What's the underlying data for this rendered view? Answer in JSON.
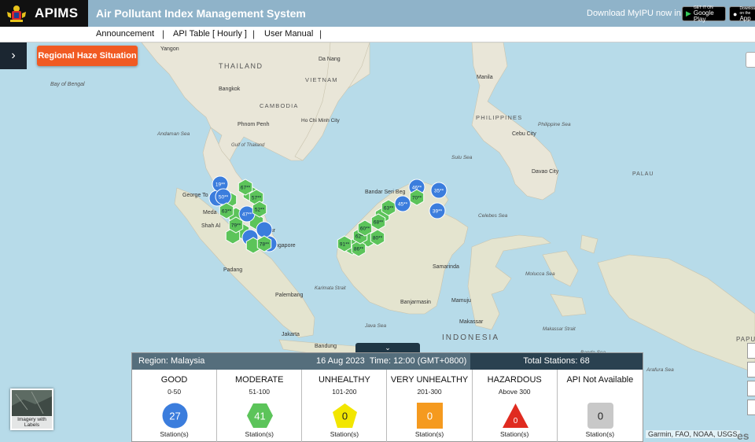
{
  "header": {
    "brand": "APIMS",
    "title": "Air Pollutant Index Management System",
    "download_text": "Download MyIPU now in",
    "google_play_small": "GET IT ON",
    "google_play": "Google Play",
    "app_store_small": "Download on the",
    "app_store": "App"
  },
  "nav": {
    "items": [
      "Announcement",
      "API Table [ Hourly ]",
      "User Manual"
    ]
  },
  "haze_button": "Regional Haze Situation",
  "sidebar_toggle": "›",
  "basemap": {
    "caption": "Imagery with Labels"
  },
  "collapse_arrow": "⌄",
  "map_labels": {
    "countries": [
      "THAILAND",
      "VIETNAM",
      "CAMBODIA",
      "PHILIPPINES",
      "INDONESIA",
      "PALAU",
      "PAPU"
    ],
    "places": [
      "Yangon",
      "Da Nang",
      "Bangkok",
      "Manila",
      "Phnom Penh",
      "Ho Chi Minh City",
      "George To",
      "Meda",
      "Shah Al",
      "pur",
      "ngapore",
      "Padang",
      "Palembang",
      "Jakarta",
      "Bandung",
      "Bandar Seri Beg",
      "Cebu City",
      "Davao City",
      "Samarinda",
      "Banjarmasin",
      "Makassar",
      "Mamuju"
    ],
    "seas": [
      "Bay of Bengal",
      "Andaman Sea",
      "Gulf of Thailand",
      "Philippine Sea",
      "Sulu Sea",
      "Celebes Sea",
      "Molucca Sea",
      "Banda Sea",
      "Java Sea",
      "Karimata Strait",
      "Arafura Sea",
      "Makassar Strait"
    ]
  },
  "stations": [
    {
      "v": "19",
      "t": "good"
    },
    {
      "v": "50",
      "t": "good"
    },
    {
      "v": "63",
      "t": "moderate"
    },
    {
      "v": "47",
      "t": "good"
    },
    {
      "v": "79",
      "t": "moderate"
    },
    {
      "v": "67",
      "t": "moderate"
    },
    {
      "v": "57",
      "t": "moderate"
    },
    {
      "v": "52",
      "t": "moderate"
    },
    {
      "v": "78",
      "t": "moderate"
    },
    {
      "v": "91",
      "t": "moderate"
    },
    {
      "v": "86",
      "t": "moderate"
    },
    {
      "v": "62",
      "t": "moderate"
    },
    {
      "v": "60",
      "t": "moderate"
    },
    {
      "v": "68",
      "t": "moderate"
    },
    {
      "v": "80",
      "t": "moderate"
    },
    {
      "v": "63",
      "t": "moderate"
    },
    {
      "v": "45",
      "t": "good"
    },
    {
      "v": "46",
      "t": "good"
    },
    {
      "v": "70",
      "t": "moderate"
    },
    {
      "v": "35",
      "t": "good"
    },
    {
      "v": "39",
      "t": "good"
    }
  ],
  "panel": {
    "region": "Region: Malaysia",
    "date": "16 Aug 2023",
    "time": "Time: 12:00 (GMT+0800)",
    "total": "Total Stations: 68",
    "unit_label": "Station(s)",
    "categories": [
      {
        "label": "GOOD",
        "range": "0-50",
        "count": "27",
        "color": "#3b7ddd",
        "shape": "circle"
      },
      {
        "label": "MODERATE",
        "range": "51-100",
        "count": "41",
        "color": "#5cc45a",
        "shape": "hexagon"
      },
      {
        "label": "UNHEALTHY",
        "range": "101-200",
        "count": "0",
        "color": "#f2e600",
        "shape": "pentagon"
      },
      {
        "label": "VERY UNHEALTHY",
        "range": "201-300",
        "count": "0",
        "color": "#f59a1f",
        "shape": "square"
      },
      {
        "label": "HAZARDOUS",
        "range": "Above 300",
        "count": "0",
        "color": "#e02b20",
        "shape": "triangle"
      },
      {
        "label": "API Not Available",
        "range": "",
        "count": "0",
        "color": "#c8c8c8",
        "shape": "rounded-square"
      }
    ]
  },
  "attribution": "Garmin, FAO, NOAA, USGS",
  "esri_mark": "es"
}
